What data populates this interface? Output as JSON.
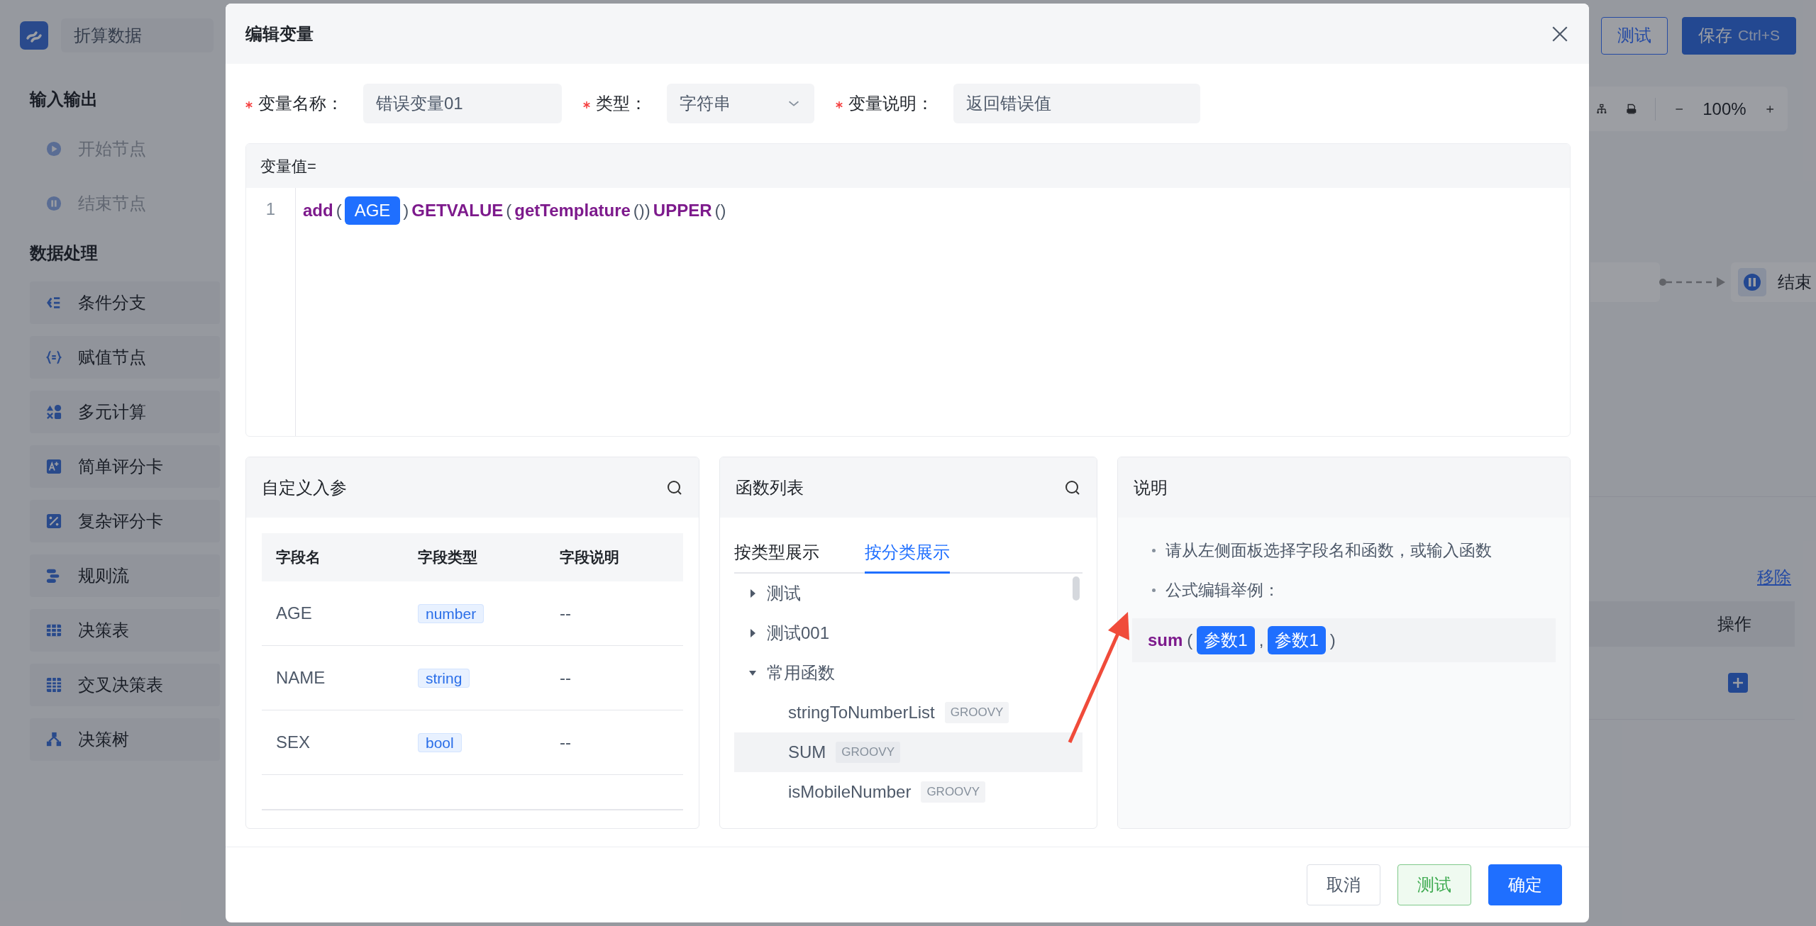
{
  "app": {
    "title": "折算数据",
    "header_buttons": [
      {
        "label": "测试",
        "kind": "outline"
      },
      {
        "label": "保存",
        "shortcut": "Ctrl+S",
        "kind": "primary"
      }
    ],
    "sidebar": {
      "sections": [
        {
          "title": "输入输出",
          "items": [
            {
              "label": "开始节点",
              "disabled": true
            },
            {
              "label": "结束节点",
              "disabled": true
            }
          ]
        },
        {
          "title": "数据处理",
          "items": [
            {
              "label": "条件分支",
              "disabled": false
            },
            {
              "label": "赋值节点",
              "disabled": false
            },
            {
              "label": "多元计算",
              "disabled": false
            },
            {
              "label": "简单评分卡",
              "disabled": false
            },
            {
              "label": "复杂评分卡",
              "disabled": false
            },
            {
              "label": "规则流",
              "disabled": false
            },
            {
              "label": "决策表",
              "disabled": false
            },
            {
              "label": "交叉决策表",
              "disabled": false
            },
            {
              "label": "决策树",
              "disabled": false
            }
          ]
        }
      ]
    },
    "toolbar": {
      "zoom": "100%"
    },
    "canvas": {
      "end_node": {
        "label": "结束"
      }
    },
    "properties": {
      "link": "移除",
      "columns": [
        "操作"
      ]
    }
  },
  "dialog": {
    "title": "编辑变量",
    "fields": [
      {
        "label": "变量名称：",
        "required": true,
        "kind": "input",
        "value": "错误变量01"
      },
      {
        "label": "类型：",
        "required": true,
        "kind": "select",
        "value": "字符串"
      },
      {
        "label": "变量说明：",
        "required": true,
        "kind": "input",
        "value": "返回错误值"
      }
    ],
    "editor": {
      "label": "变量值=",
      "lines": [
        {
          "number": "1",
          "tokens": [
            {
              "kind": "func",
              "text": "add"
            },
            {
              "kind": "punct",
              "text": "("
            },
            {
              "kind": "field",
              "text": "AGE"
            },
            {
              "kind": "punct",
              "text": ")"
            },
            {
              "kind": "func",
              "text": "GETVALUE"
            },
            {
              "kind": "punct",
              "text": "("
            },
            {
              "kind": "func",
              "text": "getTemplature"
            },
            {
              "kind": "punct",
              "text": "())"
            },
            {
              "kind": "func",
              "text": "UPPER"
            },
            {
              "kind": "punct",
              "text": "()"
            }
          ]
        }
      ]
    },
    "params_panel": {
      "title": "自定义入参",
      "columns": [
        "字段名",
        "字段类型",
        "字段说明"
      ],
      "rows": [
        {
          "name": "AGE",
          "type": "number",
          "description": "--"
        },
        {
          "name": "NAME",
          "type": "string",
          "description": "--"
        },
        {
          "name": "SEX",
          "type": "bool",
          "description": "--"
        }
      ]
    },
    "functions_panel": {
      "title": "函数列表",
      "tabs": [
        {
          "label": "按类型展示",
          "selected": false
        },
        {
          "label": "按分类展示",
          "selected": true
        }
      ],
      "tree": [
        {
          "label": "测试",
          "expanded": false
        },
        {
          "label": "测试001",
          "expanded": false
        },
        {
          "label": "常用函数",
          "expanded": true,
          "children": [
            {
              "label": "stringToNumberList",
              "tag": "GROOVY",
              "selected": false
            },
            {
              "label": "SUM",
              "tag": "GROOVY",
              "selected": true
            },
            {
              "label": "isMobileNumber",
              "tag": "GROOVY",
              "selected": false
            }
          ]
        }
      ]
    },
    "help_panel": {
      "title": "说明",
      "bullets": [
        "请从左侧面板选择字段名和函数，或输入函数",
        "公式编辑举例："
      ],
      "example": [
        {
          "kind": "func",
          "text": "sum"
        },
        {
          "kind": "punct",
          "text": "("
        },
        {
          "kind": "field",
          "text": "参数1"
        },
        {
          "kind": "punct",
          "text": ","
        },
        {
          "kind": "field",
          "text": "参数1"
        },
        {
          "kind": "punct",
          "text": ")"
        }
      ]
    },
    "buttons": [
      {
        "label": "取消",
        "kind": "default"
      },
      {
        "label": "测试",
        "kind": "success"
      },
      {
        "label": "确定",
        "kind": "primary"
      }
    ]
  }
}
